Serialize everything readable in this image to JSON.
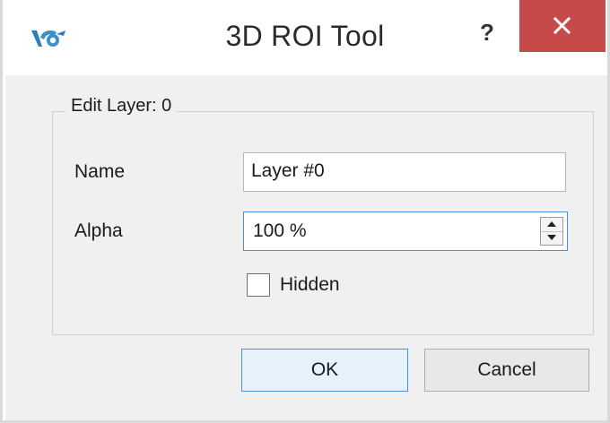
{
  "window": {
    "title": "3D ROI Tool",
    "help_label": "?",
    "app_icon": "voreen-logo-icon",
    "close_icon": "close-icon",
    "close_color": "#c74a4a"
  },
  "group": {
    "title": "Edit Layer: 0"
  },
  "form": {
    "name_label": "Name",
    "name_value": "Layer #0",
    "alpha_label": "Alpha",
    "alpha_value": "100 %",
    "hidden_label": "Hidden",
    "hidden_checked": false
  },
  "buttons": {
    "ok_label": "OK",
    "cancel_label": "Cancel"
  }
}
